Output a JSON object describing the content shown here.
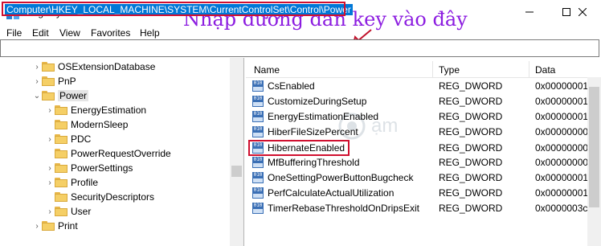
{
  "window": {
    "title": "Registry Editor",
    "icon": "registry-icon",
    "controls": [
      "minimize-icon",
      "maximize-icon",
      "close-icon"
    ]
  },
  "annotation": {
    "text": "Nhập đường dẫn key vào đây",
    "color": "#8c1de0"
  },
  "menu": [
    "File",
    "Edit",
    "View",
    "Favorites",
    "Help"
  ],
  "address": {
    "value": "Computer\\HKEY_LOCAL_MACHINE\\SYSTEM\\CurrentControlSet\\Control\\Power"
  },
  "tree": {
    "items": [
      {
        "label": "OSExtensionDatabase",
        "expander": ">"
      },
      {
        "label": "PnP",
        "expander": ">"
      },
      {
        "label": "Power",
        "expander": "v",
        "selected": true
      },
      {
        "label": "EnergyEstimation",
        "expander": ">"
      },
      {
        "label": "ModernSleep",
        "expander": ""
      },
      {
        "label": "PDC",
        "expander": ">"
      },
      {
        "label": "PowerRequestOverride",
        "expander": ""
      },
      {
        "label": "PowerSettings",
        "expander": ">"
      },
      {
        "label": "Profile",
        "expander": ">"
      },
      {
        "label": "SecurityDescriptors",
        "expander": ""
      },
      {
        "label": "User",
        "expander": ">"
      },
      {
        "label": "Print",
        "expander": ">"
      }
    ]
  },
  "list": {
    "columns": [
      "Name",
      "Type",
      "Data"
    ],
    "rows": [
      {
        "name": "CsEnabled",
        "type": "REG_DWORD",
        "data": "0x00000001"
      },
      {
        "name": "CustomizeDuringSetup",
        "type": "REG_DWORD",
        "data": "0x00000001"
      },
      {
        "name": "EnergyEstimationEnabled",
        "type": "REG_DWORD",
        "data": "0x00000001"
      },
      {
        "name": "HiberFileSizePercent",
        "type": "REG_DWORD",
        "data": "0x00000000"
      },
      {
        "name": "HibernateEnabled",
        "type": "REG_DWORD",
        "data": "0x00000000",
        "highlighted": true
      },
      {
        "name": "MfBufferingThreshold",
        "type": "REG_DWORD",
        "data": "0x00000000"
      },
      {
        "name": "OneSettingPowerButtonBugcheck",
        "type": "REG_DWORD",
        "data": "0x00000001"
      },
      {
        "name": "PerfCalculateActualUtilization",
        "type": "REG_DWORD",
        "data": "0x00000001"
      },
      {
        "name": "TimerRebaseThresholdOnDripsExit",
        "type": "REG_DWORD",
        "data": "0x0000003c"
      }
    ]
  },
  "watermark": {
    "text": "ạm"
  },
  "colors": {
    "highlight": "#d01030",
    "selection": "#0078d7"
  }
}
